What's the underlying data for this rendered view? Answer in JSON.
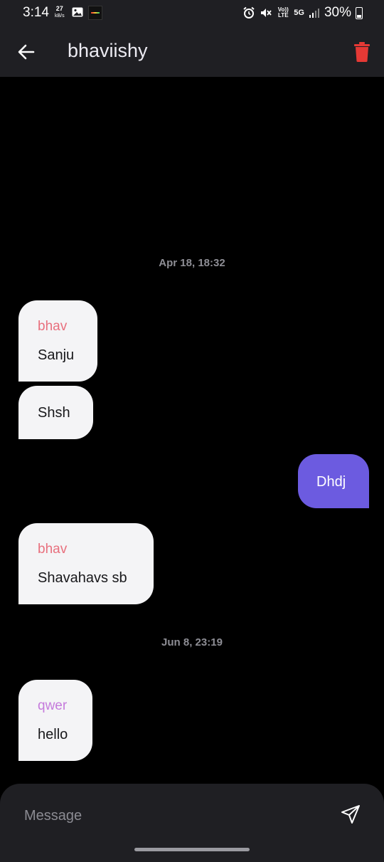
{
  "status_bar": {
    "time": "3:14",
    "net_speed_value": "27",
    "net_speed_unit": "kB/s",
    "volte_label": "Vo)) LTE",
    "network_label": "5G",
    "battery": "30%"
  },
  "header": {
    "title": "bhaviishy",
    "back_icon": "arrow-left-icon",
    "delete_icon": "trash-icon",
    "delete_color": "#e53935"
  },
  "messages": {
    "date_1": "Apr 18, 18:32",
    "date_2": "Jun 8, 23:19",
    "items": [
      {
        "sender": "bhav",
        "text": "Sanju",
        "direction": "incoming",
        "sender_color": "#e8707e"
      },
      {
        "sender": "",
        "text": "Shsh",
        "direction": "incoming"
      },
      {
        "sender": "",
        "text": "Dhdj",
        "direction": "outgoing"
      },
      {
        "sender": "bhav",
        "text": "Shavahavs sb",
        "direction": "incoming",
        "sender_color": "#e8707e"
      },
      {
        "sender": "qwer",
        "text": "hello",
        "direction": "incoming",
        "sender_color": "#c57bdc"
      }
    ]
  },
  "composer": {
    "placeholder": "Message",
    "value": "",
    "send_icon": "send-icon"
  },
  "colors": {
    "accent": "#6c5be0",
    "bar_bg": "#1f1f23",
    "chat_bg": "#000000",
    "bubble_in": "#f4f4f6"
  }
}
